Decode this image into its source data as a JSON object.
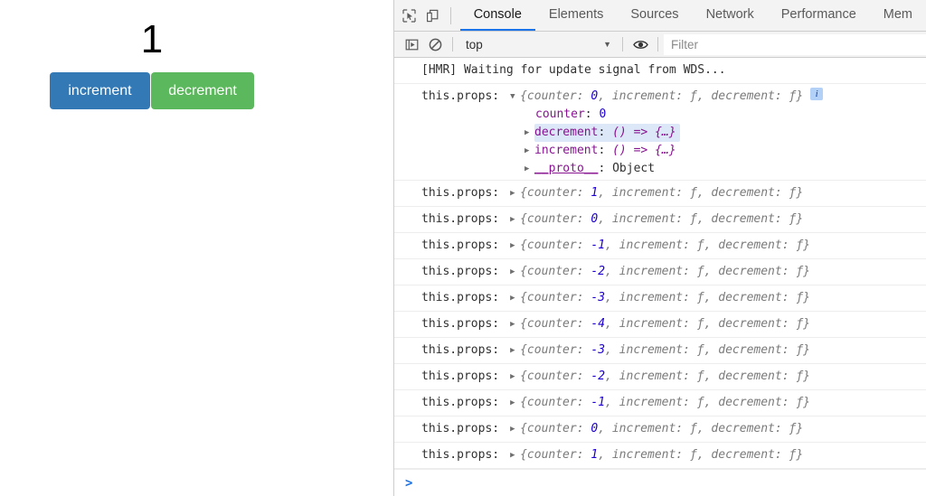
{
  "page": {
    "counter_value": "1",
    "buttons": [
      {
        "label": "increment",
        "color": "#3279b6"
      },
      {
        "label": "decrement",
        "color": "#5cb85c"
      }
    ]
  },
  "devtools": {
    "toolbar_icons": [
      {
        "name": "inspect-element-icon"
      },
      {
        "name": "device-toolbar-icon"
      }
    ],
    "tabs": [
      {
        "label": "Console",
        "active": true
      },
      {
        "label": "Elements",
        "active": false
      },
      {
        "label": "Sources",
        "active": false
      },
      {
        "label": "Network",
        "active": false
      },
      {
        "label": "Performance",
        "active": false
      },
      {
        "label": "Mem",
        "active": false
      }
    ],
    "filterbar": {
      "execute_icon": "execution-context-icon",
      "clear_icon": "clear-console-icon",
      "context_value": "top",
      "context_caret": "▼",
      "eye_icon": "live-expression-eye-icon",
      "filter_placeholder": "Filter",
      "filter_value": ""
    },
    "accent_color": "#1a73e8",
    "prompt_chevron": ">"
  },
  "console": {
    "messages": [
      {
        "type": "plain",
        "text": "[HMR] Waiting for update signal from WDS...",
        "label": "",
        "expanded": false
      },
      {
        "type": "object",
        "label": "this.props:",
        "expanded": true,
        "disclosure": "▼",
        "preview_open": "{counter: ",
        "counter": "0",
        "preview_rest": ", increment: ƒ, decrement: ƒ}",
        "info_badge": "i",
        "properties": [
          {
            "arrow": "",
            "key": "counter",
            "sep": ": ",
            "value": "0",
            "kind": "num",
            "highlight": false
          },
          {
            "arrow": "▶",
            "key": "decrement",
            "sep": ": ",
            "value": "() => {…}",
            "kind": "fn",
            "highlight": true
          },
          {
            "arrow": "▶",
            "key": "increment",
            "sep": ": ",
            "value": "() => {…}",
            "kind": "fn",
            "highlight": false
          },
          {
            "arrow": "▶",
            "key": "__proto__",
            "sep": ": ",
            "value": "Object",
            "kind": "obj",
            "highlight": false
          }
        ]
      },
      {
        "type": "object",
        "label": "this.props:",
        "expanded": false,
        "disclosure": "▶",
        "preview_open": "{counter: ",
        "counter": "1",
        "preview_rest": ", increment: ƒ, decrement: ƒ}"
      },
      {
        "type": "object",
        "label": "this.props:",
        "expanded": false,
        "disclosure": "▶",
        "preview_open": "{counter: ",
        "counter": "0",
        "preview_rest": ", increment: ƒ, decrement: ƒ}"
      },
      {
        "type": "object",
        "label": "this.props:",
        "expanded": false,
        "disclosure": "▶",
        "preview_open": "{counter: ",
        "counter": "-1",
        "preview_rest": ", increment: ƒ, decrement: ƒ}"
      },
      {
        "type": "object",
        "label": "this.props:",
        "expanded": false,
        "disclosure": "▶",
        "preview_open": "{counter: ",
        "counter": "-2",
        "preview_rest": ", increment: ƒ, decrement: ƒ}"
      },
      {
        "type": "object",
        "label": "this.props:",
        "expanded": false,
        "disclosure": "▶",
        "preview_open": "{counter: ",
        "counter": "-3",
        "preview_rest": ", increment: ƒ, decrement: ƒ}"
      },
      {
        "type": "object",
        "label": "this.props:",
        "expanded": false,
        "disclosure": "▶",
        "preview_open": "{counter: ",
        "counter": "-4",
        "preview_rest": ", increment: ƒ, decrement: ƒ}"
      },
      {
        "type": "object",
        "label": "this.props:",
        "expanded": false,
        "disclosure": "▶",
        "preview_open": "{counter: ",
        "counter": "-3",
        "preview_rest": ", increment: ƒ, decrement: ƒ}"
      },
      {
        "type": "object",
        "label": "this.props:",
        "expanded": false,
        "disclosure": "▶",
        "preview_open": "{counter: ",
        "counter": "-2",
        "preview_rest": ", increment: ƒ, decrement: ƒ}"
      },
      {
        "type": "object",
        "label": "this.props:",
        "expanded": false,
        "disclosure": "▶",
        "preview_open": "{counter: ",
        "counter": "-1",
        "preview_rest": ", increment: ƒ, decrement: ƒ}"
      },
      {
        "type": "object",
        "label": "this.props:",
        "expanded": false,
        "disclosure": "▶",
        "preview_open": "{counter: ",
        "counter": "0",
        "preview_rest": ", increment: ƒ, decrement: ƒ}"
      },
      {
        "type": "object",
        "label": "this.props:",
        "expanded": false,
        "disclosure": "▶",
        "preview_open": "{counter: ",
        "counter": "1",
        "preview_rest": ", increment: ƒ, decrement: ƒ}"
      }
    ]
  }
}
